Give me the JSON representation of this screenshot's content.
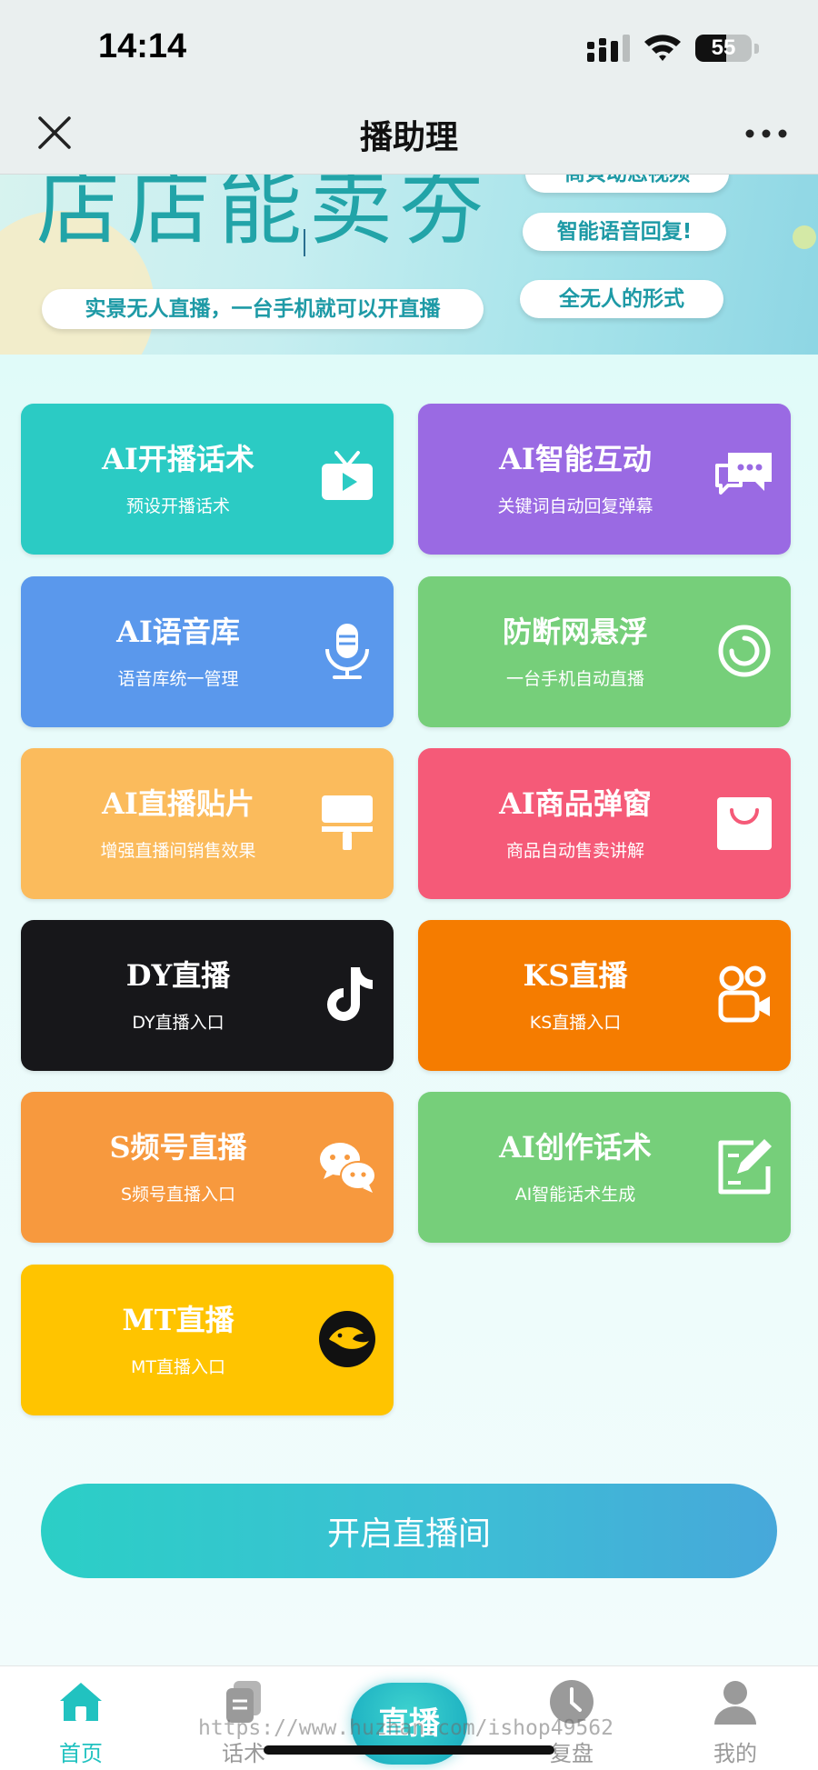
{
  "status_bar": {
    "time": "14:14",
    "battery": "55",
    "battery_level": 0.55
  },
  "nav": {
    "title": "播助理",
    "close_icon": "close-icon",
    "more_icon": "more-icon"
  },
  "banner": {
    "headline": "店店能卖夯",
    "slogan": "实景无人直播，一台手机就可以开直播",
    "pills": [
      "商貝动态视频",
      "智能语音回复!",
      "全无人的形式"
    ]
  },
  "tiles": [
    {
      "title": "AI开播话术",
      "subtitle": "预设开播话术",
      "icon": "tv-icon",
      "color": "#2bcbc4"
    },
    {
      "title": "AI智能互动",
      "subtitle": "关键词自动回复弹幕",
      "icon": "chat-bubbles-icon",
      "color": "#9a6ae3"
    },
    {
      "title": "AI语音库",
      "subtitle": "语音库统一管理",
      "icon": "microphone-icon",
      "color": "#5a98ec"
    },
    {
      "title": "防断网悬浮",
      "subtitle": "一台手机自动直播",
      "icon": "ring-icon",
      "color": "#76cf7a"
    },
    {
      "title": "AI直播贴片",
      "subtitle": "增强直播间销售效果",
      "icon": "paint-roller-icon",
      "color": "#fbbb5c"
    },
    {
      "title": "AI商品弹窗",
      "subtitle": "商品自动售卖讲解",
      "icon": "shopping-bag-icon",
      "color": "#f55a78"
    },
    {
      "title": "DY直播",
      "subtitle": "DY直播入口",
      "icon": "douyin-icon",
      "color": "#17171a"
    },
    {
      "title": "KS直播",
      "subtitle": "KS直播入口",
      "icon": "kuaishou-icon",
      "color": "#f57c00"
    },
    {
      "title": "S频号直播",
      "subtitle": "S频号直播入口",
      "icon": "wechat-icon",
      "color": "#f7993e"
    },
    {
      "title": "AI创作话术",
      "subtitle": "AI智能话术生成",
      "icon": "edit-note-icon",
      "color": "#76cf7a"
    },
    {
      "title": "MT直播",
      "subtitle": "MT直播入口",
      "icon": "meituan-icon",
      "color": "#ffc400"
    }
  ],
  "start_button": {
    "label": "开启直播间"
  },
  "tab_bar": {
    "tabs": [
      {
        "label": "首页",
        "icon": "home-icon",
        "active": true
      },
      {
        "label": "话术",
        "icon": "script-icon",
        "active": false
      },
      {
        "label": "直播",
        "icon": "live-icon",
        "active": false
      },
      {
        "label": "复盘",
        "icon": "clock-icon",
        "active": false
      },
      {
        "label": "我的",
        "icon": "user-icon",
        "active": false
      }
    ]
  },
  "watermark": "https://www.huzhan.com/ishop49562",
  "colors": {
    "accent": "#21c2c0",
    "tab_inactive": "#9a9a9a"
  }
}
